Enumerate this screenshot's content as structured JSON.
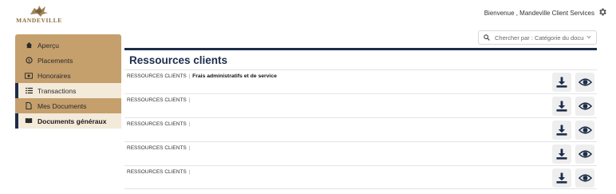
{
  "brand": {
    "logo_text": "MANDEVILLE"
  },
  "header": {
    "welcome_text": "Bienvenue , Mandeville Client Services",
    "settings_icon": "gear-icon"
  },
  "sidebar": {
    "items": [
      {
        "label": "Aperçu",
        "icon": "home-icon"
      },
      {
        "label": "Placements",
        "icon": "coin-icon"
      },
      {
        "label": "Honoraires",
        "icon": "money-icon"
      },
      {
        "label": "Transactions",
        "icon": "list-icon"
      },
      {
        "label": "Mes Documents",
        "icon": "file-icon"
      },
      {
        "label": "Documents généraux",
        "icon": "book-icon"
      }
    ]
  },
  "search": {
    "placeholder": "Chercher par : Catégorie du document",
    "icon": "search-icon"
  },
  "main": {
    "title": "Ressources clients",
    "rows": [
      {
        "category": "RESSOURCES CLIENTS",
        "separator": "|",
        "document": "Frais administratifs et de service"
      },
      {
        "category": "RESSOURCES CLIENTS",
        "separator": "|",
        "document": ""
      },
      {
        "category": "RESSOURCES CLIENTS",
        "separator": "|",
        "document": ""
      },
      {
        "category": "RESSOURCES CLIENTS",
        "separator": "|",
        "document": ""
      },
      {
        "category": "RESSOURCES CLIENTS",
        "separator": "|",
        "document": ""
      }
    ]
  },
  "colors": {
    "navy": "#1d2d4a",
    "gold": "#c5a06d",
    "sidebar_light": "#f3ead9"
  }
}
